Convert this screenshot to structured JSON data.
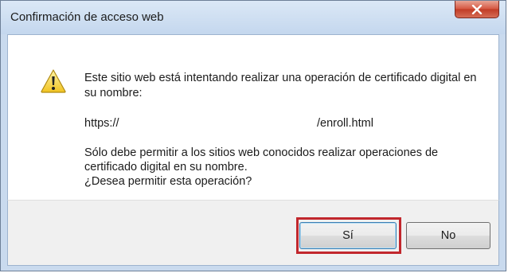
{
  "window": {
    "title": "Confirmación de acceso web",
    "close_icon": "close-icon"
  },
  "dialog": {
    "icon": "warning-icon",
    "message": "Este sitio web está intentando realizar una operación de certificado digital en su nombre:",
    "url_protocol": "https://",
    "url_path": "/enroll.html",
    "note_line1": "Sólo debe permitir a los sitios web conocidos realizar operaciones de certificado digital en su nombre.",
    "question": "¿Desea permitir esta operación?"
  },
  "buttons": {
    "yes_label": "Sí",
    "no_label": "No"
  },
  "colors": {
    "highlight": "#c1272d",
    "titlebar": "#c9daee"
  }
}
